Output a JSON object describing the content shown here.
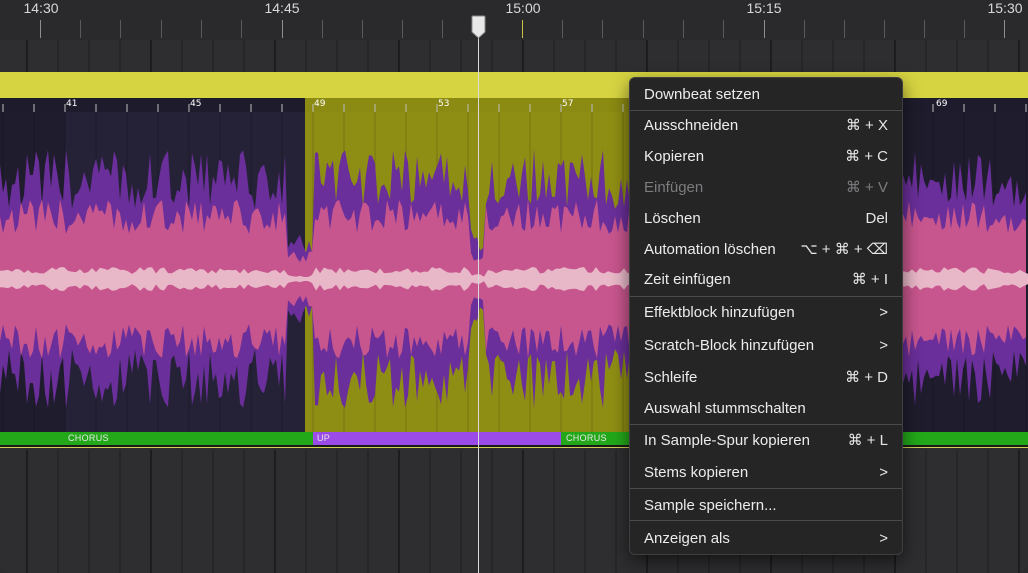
{
  "timeline": {
    "labels": [
      "14:30",
      "14:45",
      "15:00",
      "15:15",
      "15:30"
    ]
  },
  "bars": {
    "numbers": [
      "41",
      "45",
      "49",
      "53",
      "57",
      "69"
    ]
  },
  "sections": {
    "chorus_1": "CHORUS",
    "up": "UP",
    "chorus_2": "CHORUS"
  },
  "colors": {
    "accent_yellow": "#d7d442",
    "highlight_region": "#8f8e14",
    "waveform_pink": "#d05a8d",
    "waveform_purple": "#6a2f9a",
    "section_green": "#23a81a",
    "section_purple": "#9b4be8",
    "menu_bg": "#252526"
  },
  "context_menu": {
    "items": [
      {
        "label": "Downbeat setzen",
        "shortcut": ""
      },
      {
        "label": "Ausschneiden",
        "shortcut": "⌘ + X"
      },
      {
        "label": "Kopieren",
        "shortcut": "⌘ + C"
      },
      {
        "label": "Einfügen",
        "shortcut": "⌘ + V",
        "disabled": true
      },
      {
        "label": "Löschen",
        "shortcut": "Del"
      },
      {
        "label": "Automation löschen",
        "shortcut": "⌥ + ⌘ + ⌫"
      },
      {
        "label": "Zeit einfügen",
        "shortcut": "⌘ + I"
      },
      {
        "label": "Effektblock hinzufügen",
        "submenu": true
      },
      {
        "label": "Scratch-Block hinzufügen",
        "submenu": true
      },
      {
        "label": "Schleife",
        "shortcut": "⌘ + D"
      },
      {
        "label": "Auswahl stummschalten",
        "shortcut": ""
      },
      {
        "label": "In Sample-Spur kopieren",
        "shortcut": "⌘ + L"
      },
      {
        "label": "Stems kopieren",
        "submenu": true
      },
      {
        "label": "Sample speichern...",
        "shortcut": ""
      },
      {
        "label": "Anzeigen als",
        "submenu": true
      }
    ],
    "submenu_arrow": ">"
  }
}
